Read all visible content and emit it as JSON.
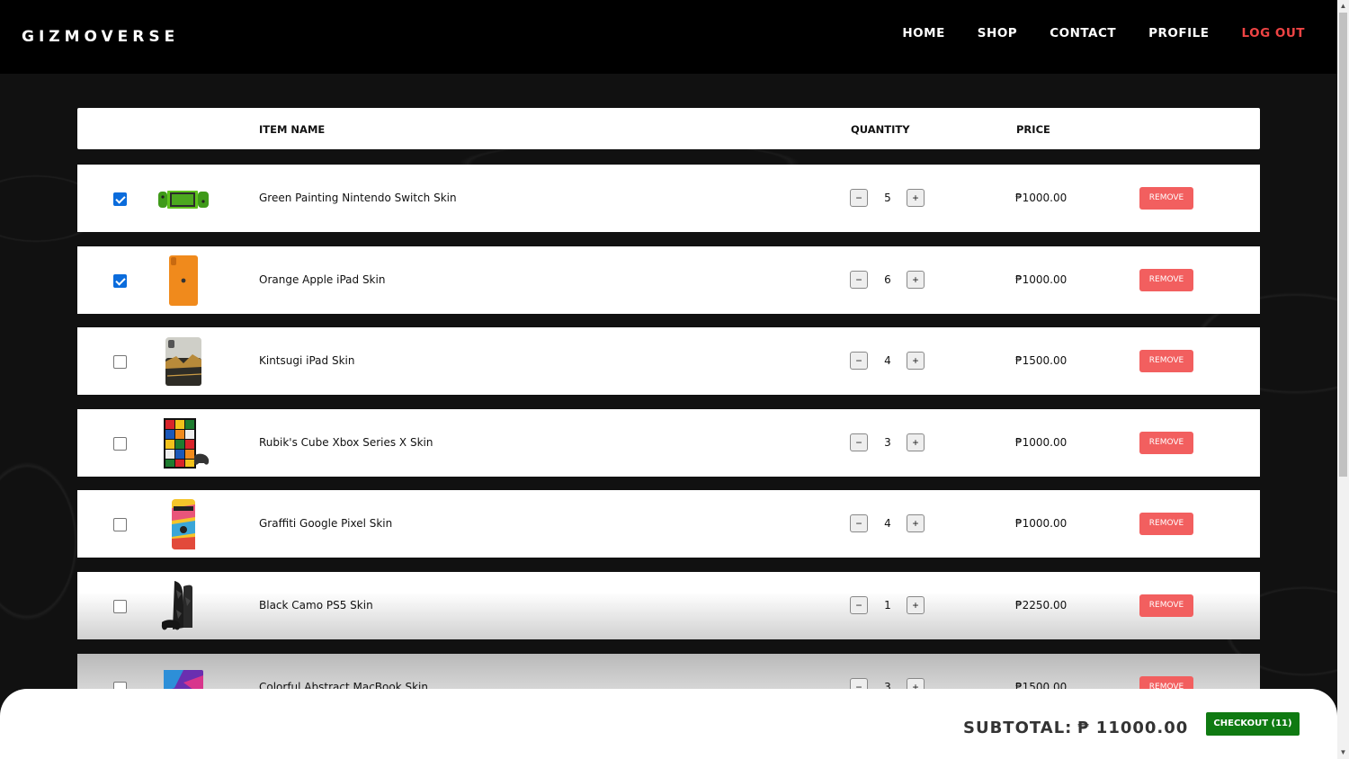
{
  "brand": "GIZMOVERSE",
  "nav": {
    "home": "HOME",
    "shop": "SHOP",
    "contact": "CONTACT",
    "profile": "PROFILE",
    "logout": "LOG OUT"
  },
  "table": {
    "col_item": "ITEM NAME",
    "col_qty": "QUANTITY",
    "col_price": "PRICE"
  },
  "items": [
    {
      "name": "Green Painting Nintendo Switch Skin",
      "qty": "5",
      "price": "₱1000.00",
      "checked": true,
      "remove": "REMOVE",
      "minus": "−",
      "plus": "+",
      "thumb": "nintendo-switch-green-icon"
    },
    {
      "name": "Orange Apple iPad Skin",
      "qty": "6",
      "price": "₱1000.00",
      "checked": true,
      "remove": "REMOVE",
      "minus": "−",
      "plus": "+",
      "thumb": "ipad-orange-icon"
    },
    {
      "name": "Kintsugi iPad Skin",
      "qty": "4",
      "price": "₱1500.00",
      "checked": false,
      "remove": "REMOVE",
      "minus": "−",
      "plus": "+",
      "thumb": "ipad-kintsugi-icon"
    },
    {
      "name": "Rubik's Cube Xbox Series X Skin",
      "qty": "3",
      "price": "₱1000.00",
      "checked": false,
      "remove": "REMOVE",
      "minus": "−",
      "plus": "+",
      "thumb": "xbox-rubiks-icon"
    },
    {
      "name": "Graffiti Google Pixel Skin",
      "qty": "4",
      "price": "₱1000.00",
      "checked": false,
      "remove": "REMOVE",
      "minus": "−",
      "plus": "+",
      "thumb": "pixel-graffiti-icon"
    },
    {
      "name": "Black Camo PS5 Skin",
      "qty": "1",
      "price": "₱2250.00",
      "checked": false,
      "remove": "REMOVE",
      "minus": "−",
      "plus": "+",
      "thumb": "ps5-black-camo-icon"
    },
    {
      "name": "Colorful Abstract MacBook Skin",
      "qty": "3",
      "price": "₱1500.00",
      "checked": false,
      "remove": "REMOVE",
      "minus": "−",
      "plus": "+",
      "thumb": "macbook-abstract-icon"
    }
  ],
  "footer": {
    "subtotal_label": "SUBTOTAL:",
    "subtotal_value": "₱ 11000.00",
    "checkout": "CHECKOUT (11)"
  },
  "colors": {
    "remove": "#f25f5f",
    "checkout": "#0f7a12",
    "logout": "#ef4444",
    "checkbox": "#0b6cdc"
  }
}
